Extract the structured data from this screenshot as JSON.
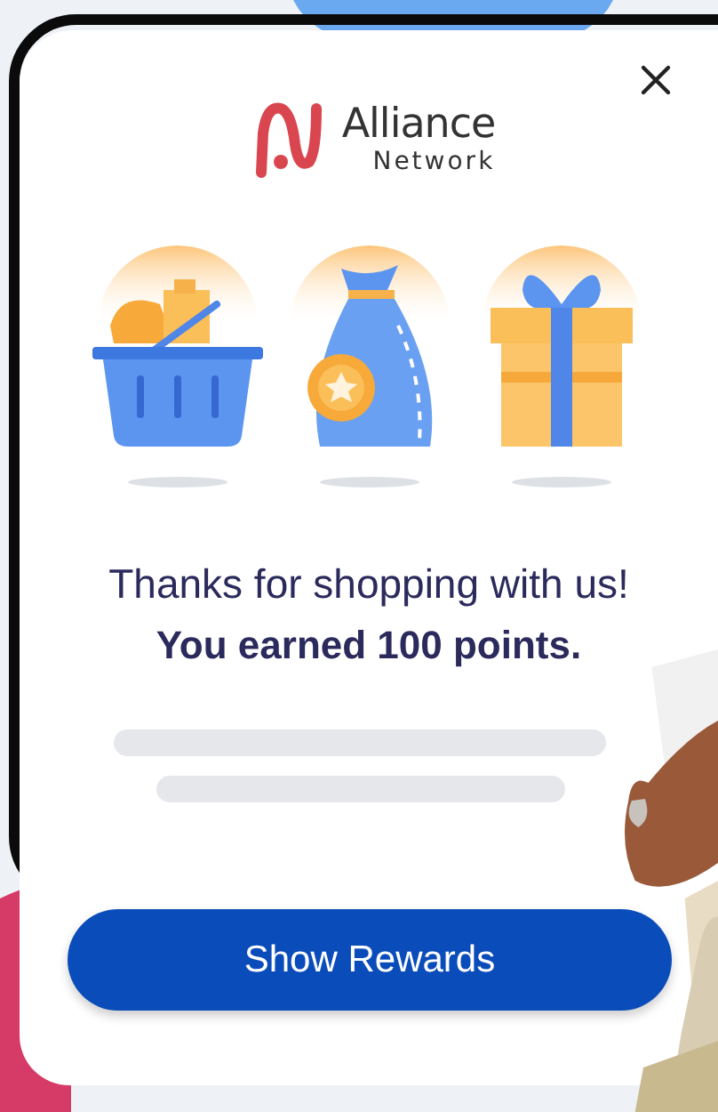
{
  "logo": {
    "name": "Alliance",
    "subtitle": "Network"
  },
  "message": {
    "title": "Thanks for shopping with us!",
    "points": "You earned 100 points."
  },
  "illustrations": [
    {
      "kind": "basket"
    },
    {
      "kind": "bag"
    },
    {
      "kind": "gift"
    }
  ],
  "primary_button": {
    "label": "Show Rewards"
  }
}
